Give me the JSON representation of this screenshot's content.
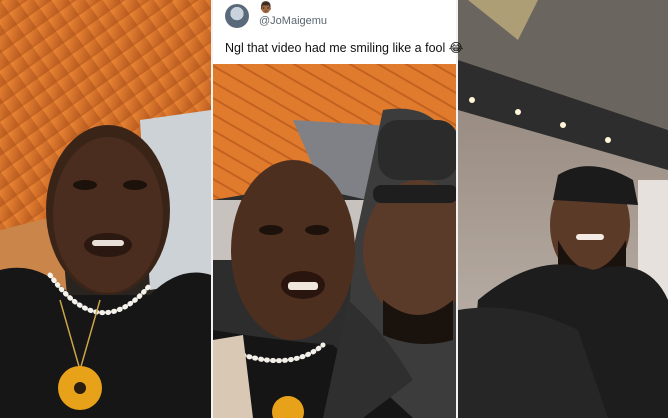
{
  "tweet": {
    "handle": "@JoMaigemu",
    "text": "Ngl that video had me smiling like a fool",
    "emoji": "😂",
    "avatar_icon": "profile-avatar",
    "badge_icon": "person-emoji"
  },
  "photos": [
    {
      "subject": "man-with-pendant-necklace"
    },
    {
      "subject": "two-men-embracing"
    },
    {
      "subject": "man-in-cap-smiling"
    }
  ],
  "colors": {
    "ceiling_orange": "#d9732a",
    "card_bg": "#ffffff",
    "divider": "#f2f2f2"
  }
}
